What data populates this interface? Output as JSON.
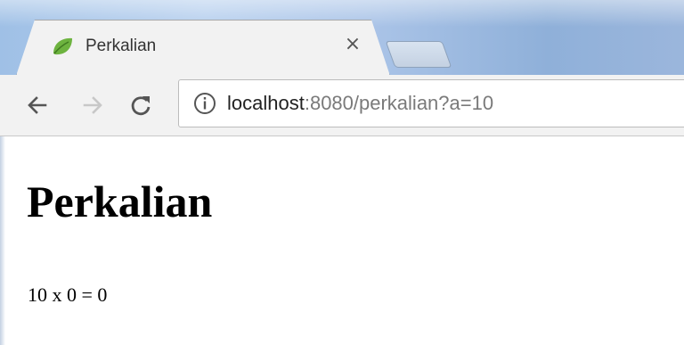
{
  "browser": {
    "tab": {
      "title": "Perkalian",
      "close_label": "×"
    },
    "address_bar": {
      "host": "localhost",
      "path": ":8080/perkalian?a=10"
    }
  },
  "page": {
    "heading": "Perkalian",
    "result": "10 x 0 = 0"
  }
}
